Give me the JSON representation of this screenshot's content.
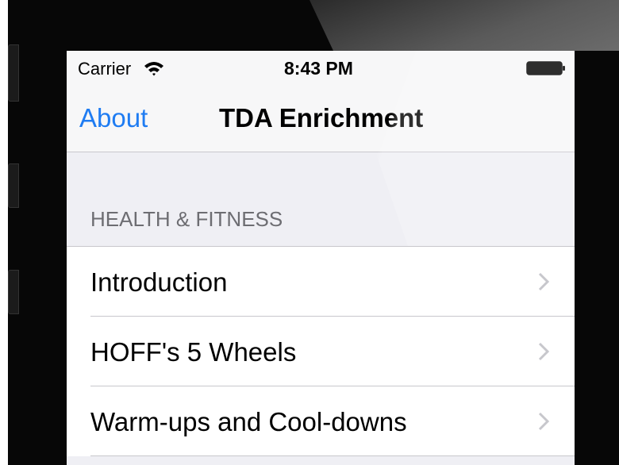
{
  "status_bar": {
    "carrier": "Carrier",
    "time": "8:43 PM"
  },
  "navbar": {
    "left_button": "About",
    "title": "TDA Enrichment"
  },
  "section": {
    "header": "HEALTH & FITNESS"
  },
  "list": {
    "items": [
      {
        "label": "Introduction"
      },
      {
        "label": "HOFF's 5 Wheels"
      },
      {
        "label": "Warm-ups and Cool-downs"
      }
    ]
  },
  "colors": {
    "accent": "#1f7cf2",
    "group_background": "#efeff4",
    "separator": "#c8c7cc",
    "section_text": "#6d6d72",
    "chevron": "#c7c7cc"
  }
}
